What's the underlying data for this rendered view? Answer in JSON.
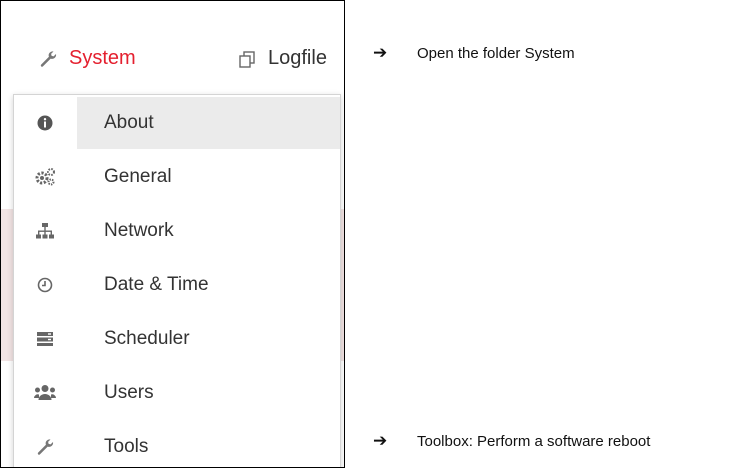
{
  "nav": {
    "items": [
      {
        "label": "System",
        "icon": "wrench-icon",
        "color": "#e4202f"
      },
      {
        "label": "Logfile",
        "icon": "copy-icon"
      }
    ]
  },
  "menu": {
    "items": [
      {
        "label": "About",
        "icon": "info-icon",
        "highlighted": true
      },
      {
        "label": "General",
        "icon": "gears-icon"
      },
      {
        "label": "Network",
        "icon": "sitemap-icon"
      },
      {
        "label": "Date & Time",
        "icon": "clock-icon"
      },
      {
        "label": "Scheduler",
        "icon": "server-icon"
      },
      {
        "label": "Users",
        "icon": "users-icon"
      },
      {
        "label": "Tools",
        "icon": "wrench-icon"
      }
    ]
  },
  "annotations": [
    {
      "arrow": "➔",
      "text": "Open the folder System"
    },
    {
      "arrow": "➔",
      "text": "Toolbox: Perform a software reboot"
    }
  ]
}
